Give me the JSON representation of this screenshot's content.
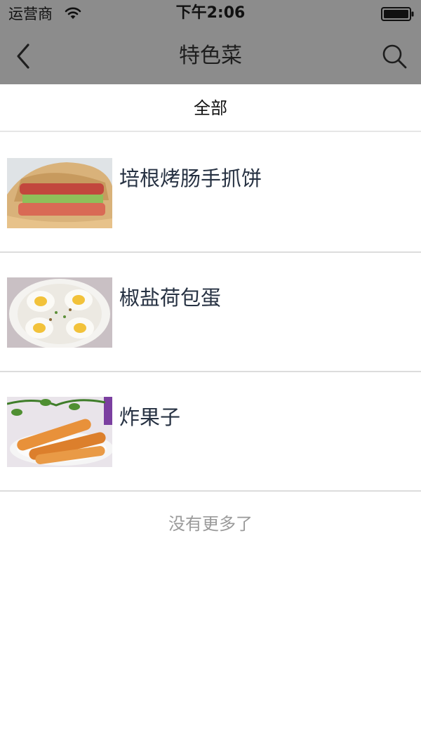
{
  "status_bar": {
    "carrier": "运营商",
    "time": "下午2:06",
    "wifi_icon": "wifi-icon",
    "battery_icon": "battery-icon"
  },
  "nav": {
    "title": "特色菜",
    "back_icon": "chevron-left-icon",
    "search_icon": "search-icon"
  },
  "filter": {
    "label": "全部"
  },
  "dishes": [
    {
      "name": "培根烤肠手抓饼",
      "image": "bacon-sausage-pancake-photo"
    },
    {
      "name": "椒盐荷包蛋",
      "image": "salt-pepper-fried-eggs-photo"
    },
    {
      "name": "炸果子",
      "image": "fried-dough-sticks-photo"
    }
  ],
  "footer": {
    "no_more": "没有更多了"
  },
  "colors": {
    "nav_background": "#8c8c8c",
    "title_text": "#263142",
    "muted_text": "#9a9a9a",
    "divider": "#dcdcdc"
  }
}
